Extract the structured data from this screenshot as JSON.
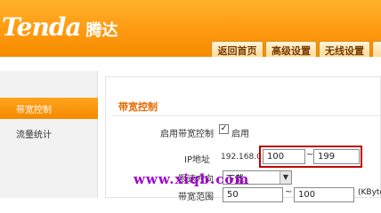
{
  "brand": {
    "name_en": "Tenda",
    "name_cn": "腾达"
  },
  "nav": {
    "tabs": [
      "返回首页",
      "高级设置",
      "无线设置"
    ]
  },
  "sidebar": {
    "items": [
      {
        "label": "带宽控制",
        "active": true
      },
      {
        "label": "流量统计",
        "active": false
      }
    ]
  },
  "panel": {
    "title": "带宽控制",
    "enable_label": "启用带宽控制",
    "enable_checkbox_label": "启用",
    "ip_label": "IP地址",
    "ip_prefix": "192.168.0.",
    "ip_start": "100",
    "ip_end": "199",
    "separator": "~",
    "direction_label": "限速方向",
    "direction_value": "下载",
    "range_label": "带宽范围",
    "range_min": "50",
    "range_max": "100",
    "range_unit": "(KByte/s)"
  },
  "watermark": "www.xiqb.com",
  "colors": {
    "brand_orange": "#f58a00",
    "title_orange": "#e46b00",
    "highlight_red": "#c00000",
    "watermark_purple": "#a000c8"
  }
}
